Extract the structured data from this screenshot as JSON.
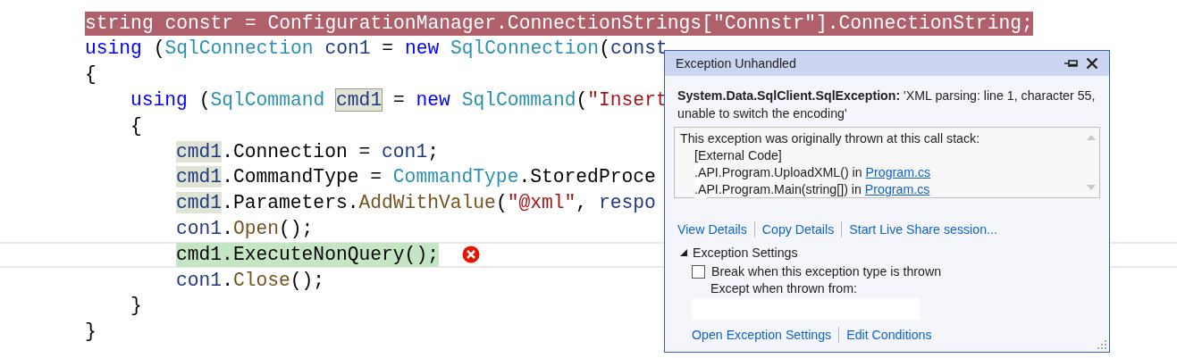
{
  "code": {
    "lines": [
      {
        "exception_line": true,
        "tokens": [
          {
            "t": "string constr = ConfigurationManager.ConnectionStrings[\"Connstr\"].ConnectionString;",
            "kind": "plain"
          }
        ]
      },
      {
        "tokens": [
          {
            "t": "using",
            "kind": "keyword"
          },
          {
            "t": " (",
            "kind": "plain"
          },
          {
            "t": "SqlConnection",
            "kind": "type"
          },
          {
            "t": " con1",
            "kind": "variable"
          },
          {
            "t": " = ",
            "kind": "plain"
          },
          {
            "t": "new",
            "kind": "keyword"
          },
          {
            "t": " SqlConnection",
            "kind": "type"
          },
          {
            "t": "(",
            "kind": "plain"
          },
          {
            "t": "const",
            "kind": "variable"
          }
        ]
      },
      {
        "tokens": [
          {
            "t": "{",
            "kind": "plain"
          }
        ],
        "children": [
          {
            "tokens": [
              {
                "t": "using",
                "kind": "keyword"
              },
              {
                "t": " (",
                "kind": "plain"
              },
              {
                "t": "SqlCommand ",
                "kind": "type"
              },
              {
                "t": "cmd1",
                "kind": "variable",
                "highlighted": true,
                "definition": true
              },
              {
                "t": " = ",
                "kind": "plain"
              },
              {
                "t": "new",
                "kind": "keyword"
              },
              {
                "t": " SqlCommand",
                "kind": "type"
              },
              {
                "t": "(",
                "kind": "plain"
              },
              {
                "t": "\"Insert",
                "kind": "string"
              }
            ]
          },
          {
            "tokens": [
              {
                "t": "{",
                "kind": "plain"
              }
            ],
            "children": [
              {
                "tokens": [
                  {
                    "t": "cmd1",
                    "kind": "variable",
                    "highlighted": true
                  },
                  {
                    "t": ".Connection = ",
                    "kind": "plain"
                  },
                  {
                    "t": "con1",
                    "kind": "variable"
                  },
                  {
                    "t": ";",
                    "kind": "plain"
                  }
                ]
              },
              {
                "tokens": [
                  {
                    "t": "cmd1",
                    "kind": "variable",
                    "highlighted": true
                  },
                  {
                    "t": ".CommandType = ",
                    "kind": "plain"
                  },
                  {
                    "t": "CommandType",
                    "kind": "type"
                  },
                  {
                    "t": ".StoredProce",
                    "kind": "plain"
                  }
                ]
              },
              {
                "tokens": [
                  {
                    "t": "cmd1",
                    "kind": "variable",
                    "highlighted": true
                  },
                  {
                    "t": ".Parameters.",
                    "kind": "plain"
                  },
                  {
                    "t": "AddWithValue",
                    "kind": "method"
                  },
                  {
                    "t": "(",
                    "kind": "plain"
                  },
                  {
                    "t": "\"@xml\"",
                    "kind": "string"
                  },
                  {
                    "t": ", ",
                    "kind": "plain"
                  },
                  {
                    "t": "respo",
                    "kind": "variable"
                  }
                ]
              },
              {
                "tokens": [
                  {
                    "t": "con1",
                    "kind": "variable"
                  },
                  {
                    "t": ".",
                    "kind": "plain"
                  },
                  {
                    "t": "Open",
                    "kind": "method"
                  },
                  {
                    "t": "();",
                    "kind": "plain"
                  }
                ]
              },
              {
                "current": true,
                "error": true,
                "tokens": [
                  {
                    "t": "cmd1.ExecuteNonQuery();",
                    "kind": "plain"
                  }
                ]
              },
              {
                "tokens": [
                  {
                    "t": "con1",
                    "kind": "variable"
                  },
                  {
                    "t": ".",
                    "kind": "plain"
                  },
                  {
                    "t": "Close",
                    "kind": "method"
                  },
                  {
                    "t": "();",
                    "kind": "plain"
                  }
                ]
              }
            ]
          },
          {
            "tokens": [
              {
                "t": "}",
                "kind": "plain"
              }
            ]
          }
        ]
      },
      {
        "tokens": [
          {
            "t": "}",
            "kind": "plain"
          }
        ]
      }
    ]
  },
  "popup": {
    "title": "Exception Unhandled",
    "exception_type": "System.Data.SqlClient.SqlException:",
    "message": "'XML parsing: line 1, character 55, unable to switch the encoding'",
    "stack_header": "This exception was originally thrown at this call stack:",
    "stack": [
      {
        "text": "[External Code]"
      },
      {
        "text": ".API.Program.UploadXML() in ",
        "link": "Program.cs"
      },
      {
        "text": ".API.Program.Main(string[]) in ",
        "link": "Program.cs"
      }
    ],
    "actions": [
      "View Details",
      "Copy Details",
      "Start Live Share session..."
    ],
    "settings": {
      "title": "Exception Settings",
      "expanded": true,
      "break_label": "Break when this exception type is thrown",
      "checked": false,
      "except_label": "Except when thrown from:",
      "links": [
        "Open Exception Settings",
        "Edit Conditions"
      ]
    }
  }
}
